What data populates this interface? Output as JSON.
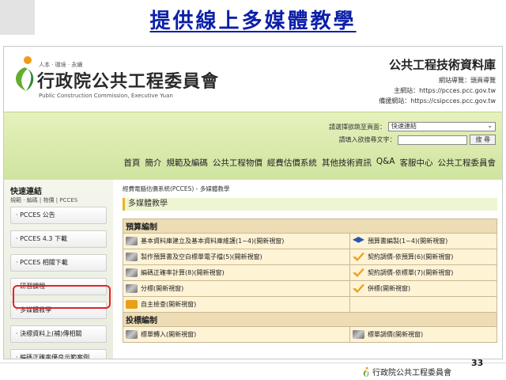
{
  "slide": {
    "title": "提供線上多媒體教學",
    "page_number": "33",
    "footer_logo": "行政院公共工程委員會"
  },
  "site": {
    "logo_top": "人本 · 環境 · 永續",
    "logo_cn": "行政院公共工程委員會",
    "logo_en": "Public Construction Commission, Executive Yuan",
    "db_title": "公共工程技術資料庫",
    "guide": "網站導覽：頭頁導覽",
    "main_site": "主網站：https://pcces.pcc.gov.tw",
    "backup_site": "備援網站：https://csipcces.pcc.gov.tw",
    "select_label": "請選擇欲跳至頁面：",
    "select_value": "快速連結",
    "search_label": "請填入欲搜尋文字：",
    "search_value": "",
    "search_button": "搜 尋",
    "nav": [
      "首頁",
      "簡介",
      "規範及編碼",
      "公共工程物價",
      "經費估價系統",
      "其他技術資訊",
      "Q&A",
      "客服中心",
      "公共工程委員會"
    ]
  },
  "sidebar": {
    "title": "快速連結",
    "subtitle": "規範 · 編碼 | 物價 | PCCES",
    "items": [
      "· PCCES 公告",
      "· PCCES 4.3 下載",
      "· PCCES 相關下載",
      "· 研習課程",
      "· 多媒體教學",
      "· 決標資料上(補)傳相關",
      "· 編碼正確率優良示範案例"
    ]
  },
  "main": {
    "breadcrumb": "經費電腦估價系統(PCCES) - 多媒體教學",
    "section_title": "多媒體教學",
    "categories": [
      {
        "name": "預算編制",
        "rows": [
          [
            {
              "icon": "book-icon",
              "text": "基本資料庫建立及基本資料庫維護(1~4)(開新視窗)"
            },
            {
              "icon": "graduation-cap-icon",
              "text": "預算書編製(1~4)(開新視窗)"
            }
          ],
          [
            {
              "icon": "book-icon",
              "text": "製作預算書及空白標單電子檔(5)(開新視窗)"
            },
            {
              "icon": "checkmark-icon",
              "text": "契約調價-依預算(6)(開新視窗)"
            }
          ],
          [
            {
              "icon": "book-icon",
              "text": "編碼正確率計算(8)(開新視窗)"
            },
            {
              "icon": "checkmark-icon",
              "text": "契約調價-依標單(7)(開新視窗)"
            }
          ],
          [
            {
              "icon": "book-icon",
              "text": "分標(開新視窗)"
            },
            {
              "icon": "checkmark-icon",
              "text": "併標(開新視窗)"
            }
          ],
          [
            {
              "icon": "box-icon",
              "text": "自主檢查(開新視窗)"
            },
            {
              "icon": "",
              "text": ""
            }
          ]
        ]
      },
      {
        "name": "投標編制",
        "rows": [
          [
            {
              "icon": "book-icon",
              "text": "標單轉入(開新視窗)"
            },
            {
              "icon": "book-icon",
              "text": "標單調價(開新視窗)"
            }
          ]
        ]
      }
    ]
  },
  "colors": {
    "title_blue": "#0c1fa8",
    "highlight_red": "#e5232a",
    "green_bar": "#d6e8a8",
    "table_cell": "#fff3d6",
    "table_category": "#eedcb5"
  }
}
